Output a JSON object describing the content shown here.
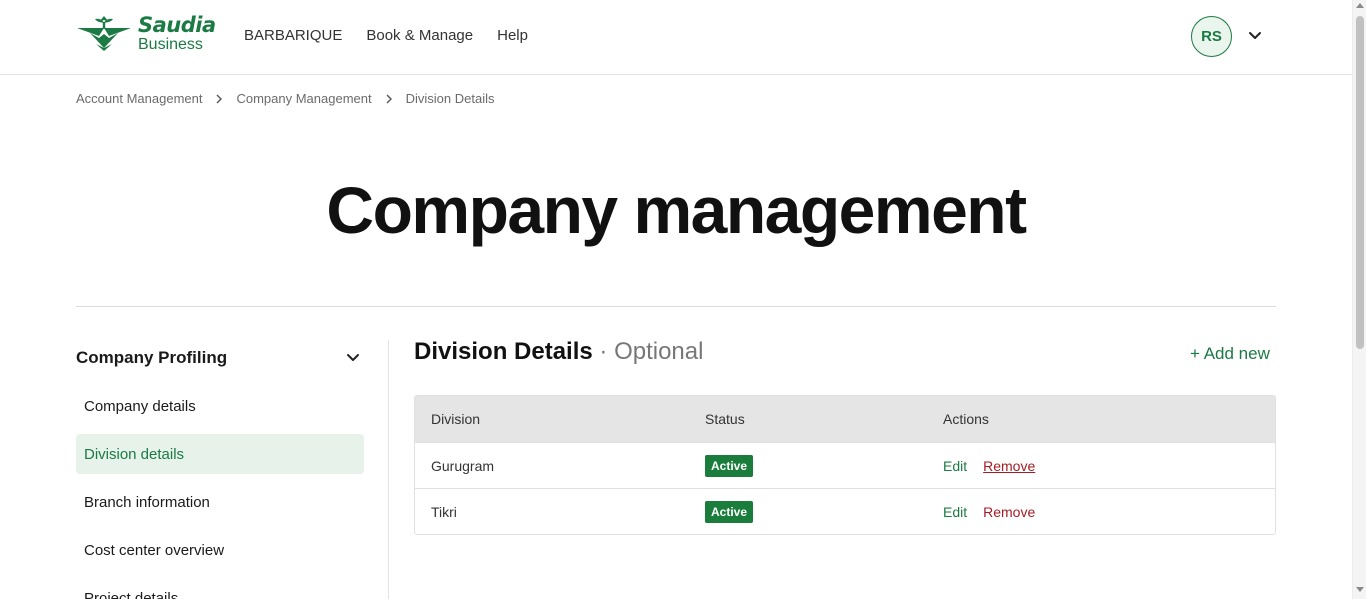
{
  "brand": {
    "name": "Saudia",
    "sub": "Business",
    "logo_icon": "saudia-palm-logo",
    "primary_color": "#1c7a44"
  },
  "nav": {
    "items": [
      "BARBARIQUE",
      "Book & Manage",
      "Help"
    ]
  },
  "user": {
    "initials": "RS"
  },
  "breadcrumb": {
    "items": [
      "Account Management",
      "Company Management",
      "Division Details"
    ]
  },
  "page": {
    "title": "Company management"
  },
  "sidebar": {
    "heading": "Company Profiling",
    "items": [
      {
        "label": "Company details",
        "active": false
      },
      {
        "label": "Division details",
        "active": true
      },
      {
        "label": "Branch information",
        "active": false
      },
      {
        "label": "Cost center overview",
        "active": false
      },
      {
        "label": "Project details",
        "active": false
      }
    ]
  },
  "section": {
    "title": "Division Details",
    "suffix": " · Optional",
    "add_label": "+ Add new"
  },
  "table": {
    "columns": [
      "Division",
      "Status",
      "Actions"
    ],
    "rows": [
      {
        "division": "Gurugram",
        "status": "Active",
        "edit": "Edit",
        "remove": "Remove"
      },
      {
        "division": "Tikri",
        "status": "Active",
        "edit": "Edit",
        "remove": "Remove"
      }
    ]
  },
  "colors": {
    "active_badge": "#1a7d3c",
    "remove_link": "#a51d24",
    "active_bg": "#e6f2ea"
  }
}
